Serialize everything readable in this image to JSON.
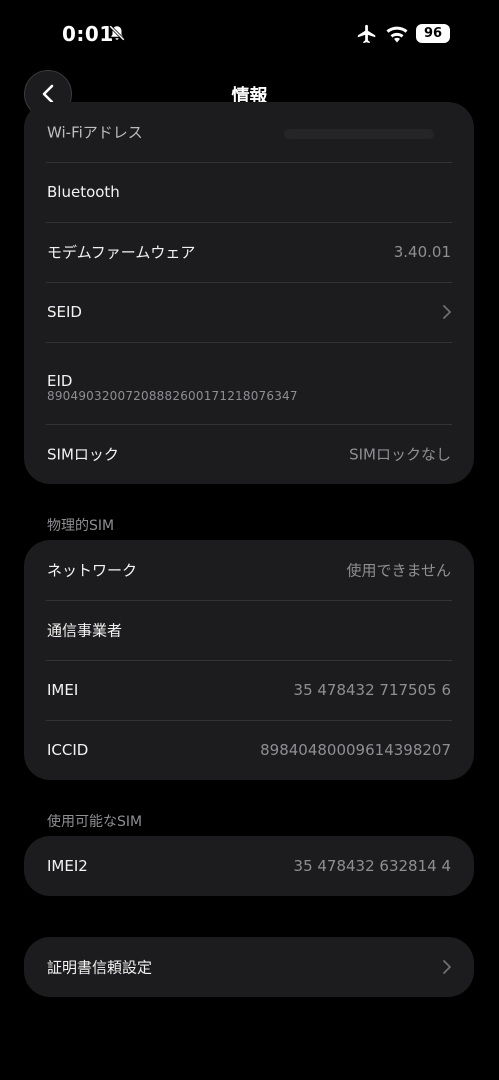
{
  "status": {
    "time": "0:01",
    "battery": "96"
  },
  "nav": {
    "title": "情報"
  },
  "card1": {
    "wifi_label": "Wi-Fiアドレス",
    "bluetooth_label": "Bluetooth",
    "modem_label": "モデムファームウェア",
    "modem_value": "3.40.01",
    "seid_label": "SEID",
    "eid_label": "EID",
    "eid_value": "89049032007208882600171218076347",
    "simlock_label": "SIMロック",
    "simlock_value": "SIMロックなし"
  },
  "physical_sim": {
    "header": "物理的SIM",
    "network_label": "ネットワーク",
    "network_value": "使用できません",
    "carrier_label": "通信事業者",
    "imei_label": "IMEI",
    "imei_value": "35 478432 717505 6",
    "iccid_label": "ICCID",
    "iccid_value": "89840480009614398207"
  },
  "available_sim": {
    "header": "使用可能なSIM",
    "imei2_label": "IMEI2",
    "imei2_value": "35 478432 632814 4"
  },
  "cert": {
    "label": "証明書信頼設定"
  },
  "icons": {
    "back": "chevron-left-icon",
    "bell": "bell-slash-icon",
    "airplane": "airplane-icon",
    "wifi": "wifi-icon",
    "chevron": "chevron-right-icon"
  }
}
